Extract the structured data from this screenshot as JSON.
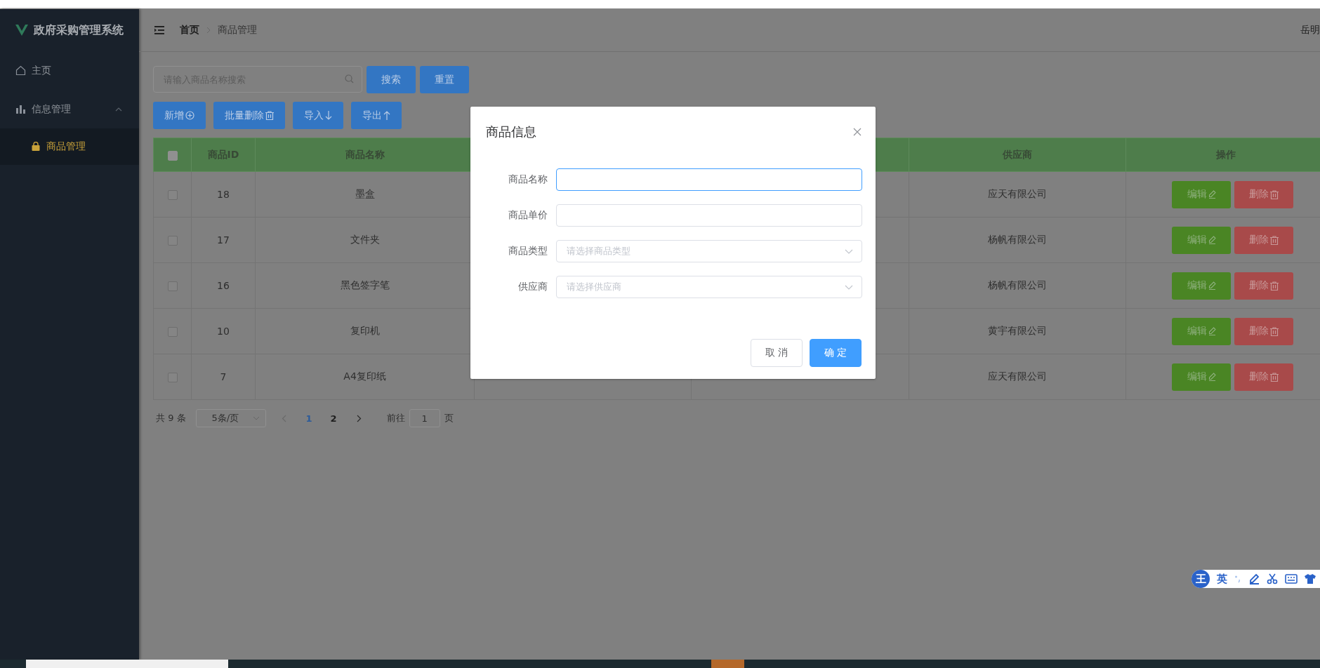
{
  "app_title": "政府采购管理系统",
  "menu": [
    {
      "label": "主页",
      "selected": false
    },
    {
      "label": "信息管理",
      "expanded": true,
      "children": [
        {
          "label": "商品管理",
          "selected": true
        }
      ]
    }
  ],
  "header": {
    "breadcrumb": [
      "首页",
      "商品管理"
    ],
    "user": "岳明"
  },
  "search": {
    "placeholder": "请输入商品名称搜索"
  },
  "search_buttons": [
    "搜索",
    "重置"
  ],
  "actions": [
    {
      "label": "新增"
    },
    {
      "label": "批量删除"
    },
    {
      "label": "导入"
    },
    {
      "label": "导出"
    }
  ],
  "table": {
    "select_all": {
      "checked": false
    },
    "columns": [
      {
        "label": "商品ID"
      },
      {
        "label": "商品名称"
      },
      {
        "label": "供应商"
      },
      {
        "label": "操作"
      }
    ],
    "rows": [
      {
        "checked": false,
        "id": "18",
        "name": "墨盒",
        "supplier": "应天有限公司",
        "buttons": [
          "编辑",
          "删除"
        ]
      },
      {
        "checked": false,
        "id": "17",
        "name": "文件夹",
        "supplier": "杨帆有限公司",
        "buttons": [
          "编辑",
          "删除"
        ]
      },
      {
        "checked": false,
        "id": "16",
        "name": "黑色签字笔",
        "supplier": "杨帆有限公司",
        "buttons": [
          "编辑",
          "删除"
        ]
      },
      {
        "checked": false,
        "id": "10",
        "name": "复印机",
        "supplier": "黄宇有限公司",
        "buttons": [
          "编辑",
          "删除"
        ]
      },
      {
        "checked": false,
        "id": "7",
        "name": "A4复印纸",
        "supplier": "应天有限公司",
        "buttons": [
          "编辑",
          "删除"
        ]
      }
    ]
  },
  "pagination": {
    "total": "共 9 条",
    "page_size": "5条/页",
    "pages": [
      {
        "label": "1",
        "selected": true
      },
      {
        "label": "2",
        "selected": false
      }
    ],
    "goto_label": "前往",
    "goto_value": "1",
    "goto_suffix": "页"
  },
  "dialog": {
    "title": "商品信息",
    "fields": [
      {
        "label": "商品名称",
        "kind": "input",
        "focused": true
      },
      {
        "label": "商品单价",
        "kind": "input",
        "focused": false
      },
      {
        "label": "商品类型",
        "kind": "select",
        "placeholder": "请选择商品类型",
        "focused": false
      },
      {
        "label": "供应商",
        "kind": "select",
        "placeholder": "请选择供应商",
        "focused": false
      }
    ],
    "buttons": [
      {
        "label": "取 消",
        "kind": "secondary"
      },
      {
        "label": "确 定",
        "kind": "primary"
      }
    ]
  },
  "ime": {
    "logo": "王",
    "mode": "英"
  }
}
